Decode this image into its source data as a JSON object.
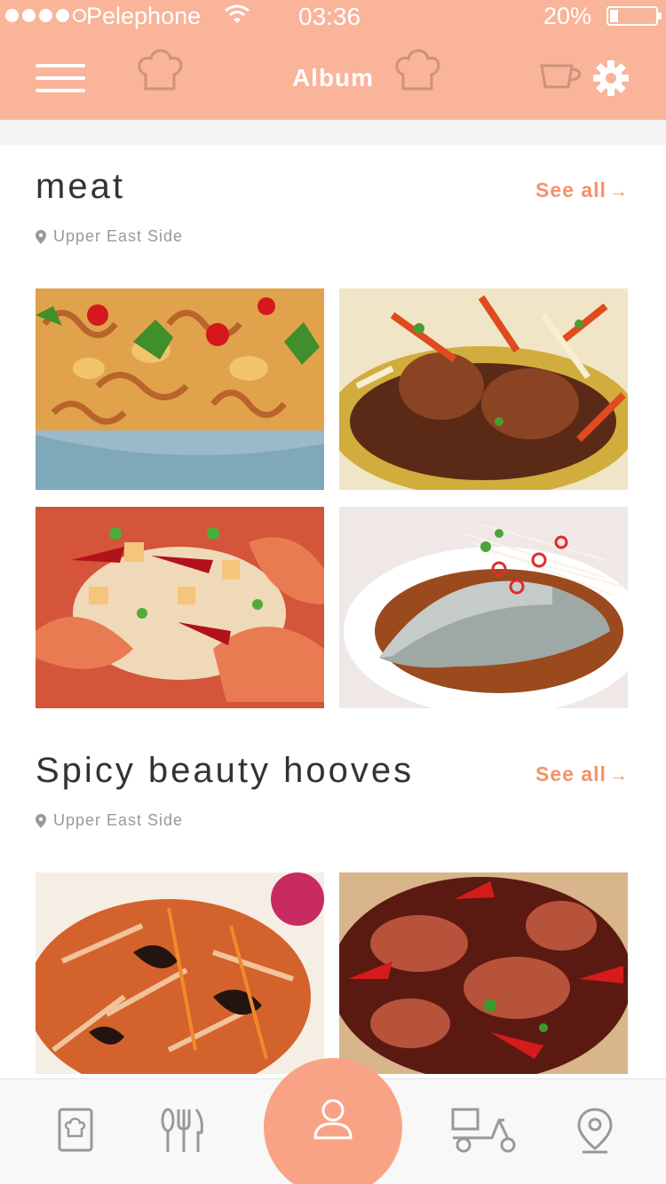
{
  "status_bar": {
    "carrier": "Pelephone",
    "time": "03:36",
    "battery": "20%"
  },
  "header": {
    "title": "Album",
    "menu_icon": "hamburger-menu-icon",
    "settings_icon": "gear-icon"
  },
  "sections": [
    {
      "title": "meat",
      "see_all": "See all",
      "location": "Upper East Side",
      "photos": [
        "octopus-dish",
        "braised-duck-dish",
        "spicy-shrimp-dish",
        "steamed-fish-dish"
      ]
    },
    {
      "title": "Spicy beauty hooves",
      "see_all": "See all",
      "location": "Upper East Side",
      "photos": [
        "shredded-pork-dish",
        "spicy-trotter-dish"
      ]
    }
  ],
  "tab_bar": {
    "tabs": [
      "recipe-book-icon",
      "utensils-icon",
      "user-icon",
      "delivery-scooter-icon",
      "map-pin-icon"
    ],
    "accent": "#f9a386"
  },
  "colors": {
    "header": "#f9b49a",
    "accent": "#f6916a"
  }
}
